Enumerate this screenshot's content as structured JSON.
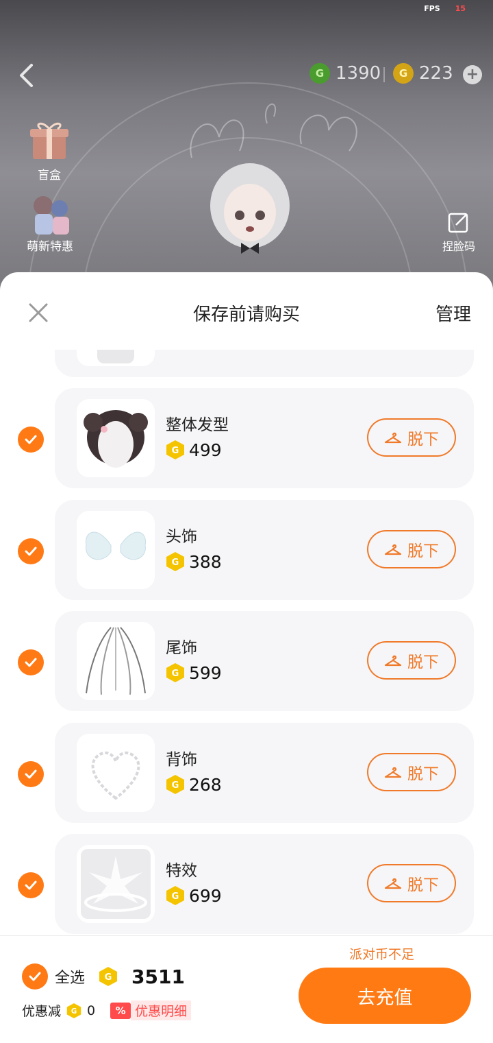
{
  "status": {
    "fps_label": "FPS",
    "fps_value": "15"
  },
  "header": {
    "green_currency": {
      "icon": "green-g-coin-icon",
      "amount": "1390"
    },
    "gold_currency": {
      "icon": "gold-g-coin-icon",
      "amount": "223"
    }
  },
  "sidebar": {
    "blind_box_label": "盲盒",
    "newbie_label": "萌新特惠",
    "face_code_label": "捏脸码"
  },
  "sheet": {
    "title": "保存前请购买",
    "manage_label": "管理",
    "remove_label": "脱下",
    "items": [
      {
        "name": "整体发型",
        "price": "499"
      },
      {
        "name": "头饰",
        "price": "388"
      },
      {
        "name": "尾饰",
        "price": "599"
      },
      {
        "name": "背饰",
        "price": "268"
      },
      {
        "name": "特效",
        "price": "699"
      }
    ]
  },
  "footer": {
    "select_all_label": "全选",
    "total": "3511",
    "discount_label": "优惠减",
    "discount_value": "0",
    "discount_badge": "%",
    "discount_detail_label": "优惠明细",
    "insufficient_label": "派对币不足",
    "recharge_label": "去充值"
  },
  "colors": {
    "accent": "#ff7a12",
    "warning": "#ff4b4b",
    "coin": "#f5c400"
  }
}
